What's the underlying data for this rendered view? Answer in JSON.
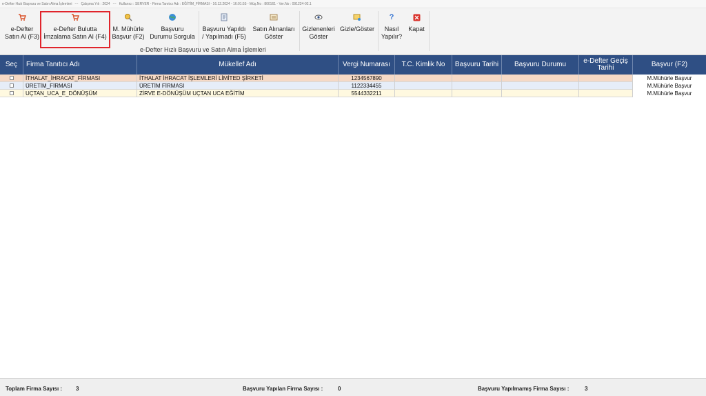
{
  "window_title": {
    "app": "e-Defter Hızlı Başvuru ve Satın Alma İşlemleri",
    "year": "Çalışma Yılı : 2024",
    "info": "Kullanıcı : SERVER - Firma Tanıtıcı Adı : EĞİTİM_FİRMASI - 16.12.2024 - 16:01:55 - Müş.No : 800161 - Ver.No : 091224-02.1"
  },
  "ribbon": {
    "buttons": [
      {
        "label": "e-Defter\nSatın Al (F3)",
        "icon": "cart-icon"
      },
      {
        "label": "e-Defter Bulutta\nİmzalama Satın Al (F4)",
        "icon": "cart-icon"
      },
      {
        "label": "M. Mühürle\nBaşvur (F2)",
        "icon": "seal-icon"
      },
      {
        "label": "Başvuru\nDurumu Sorgula",
        "icon": "globe-icon"
      },
      {
        "label": "Başvuru Yapıldı\n/ Yapılmadı (F5)",
        "icon": "document-icon"
      },
      {
        "label": "Satın Alınanları\nGöster",
        "icon": "list-icon"
      },
      {
        "label": "Gizlenenleri\nGöster",
        "icon": "eye-icon"
      },
      {
        "label": "Gizle/Göster",
        "icon": "hide-icon"
      },
      {
        "label": "Nasıl\nYapılır?",
        "icon": "help-icon"
      },
      {
        "label": "Kapat",
        "icon": "close-icon"
      }
    ],
    "group_label": "e-Defter Hızlı Başvuru ve Satın Alma İşlemleri"
  },
  "grid": {
    "columns": [
      "Seç",
      "Firma Tanıtıcı Adı",
      "Mükellef Adı",
      "Vergi Numarası",
      "T.C. Kimlik No",
      "Başvuru Tarihi",
      "Başvuru Durumu",
      "e-Defter Geçiş\nTarihi",
      "Başvur (F2)"
    ],
    "rows": [
      {
        "firma": "İTHALAT_İHRACAT_FİRMASI",
        "mukellef": "İTHALAT İHRACAT İŞLEMLERİ LİMİTED ŞİRKETİ",
        "vergi": "1234567890",
        "tc": "",
        "tarih": "",
        "durum": "",
        "gecis": "",
        "basvur": "M.Mühürle Başvur"
      },
      {
        "firma": "ÜRETİM_FİRMASI",
        "mukellef": "ÜRETİM FİRMASI",
        "vergi": "1122334455",
        "tc": "",
        "tarih": "",
        "durum": "",
        "gecis": "",
        "basvur": "M.Mühürle Başvur"
      },
      {
        "firma": "UÇTAN_UCA_E_DÖNÜŞÜM",
        "mukellef": "ZİRVE E-DÖNÜŞÜM UÇTAN UCA EĞİTİM",
        "vergi": "5544332211",
        "tc": "",
        "tarih": "",
        "durum": "",
        "gecis": "",
        "basvur": "M.Mühürle Başvur"
      }
    ]
  },
  "status": {
    "total_label": "Toplam Firma Sayısı :",
    "total_value": "3",
    "applied_label": "Başvuru Yapılan Firma Sayısı :",
    "applied_value": "0",
    "not_applied_label": "Başvuru Yapılmamış Firma Sayısı :",
    "not_applied_value": "3"
  },
  "colors": {
    "header_bg": "#2f4f84",
    "highlight_border": "#e0242b",
    "row_selected": "#f5d9c6"
  }
}
